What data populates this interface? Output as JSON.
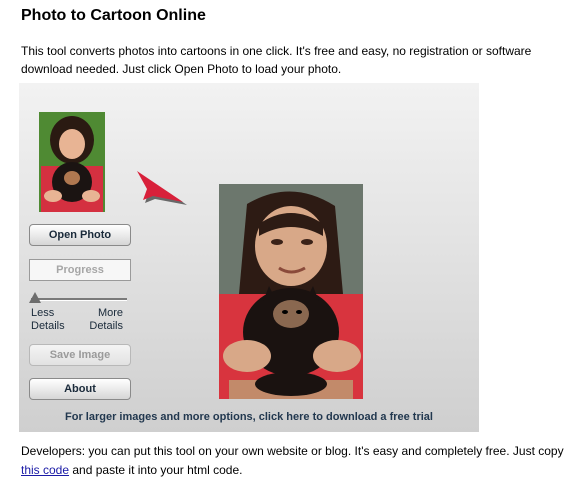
{
  "page": {
    "title": "Photo to Cartoon Online",
    "intro": "This tool converts photos into cartoons in one click. It's free and easy, no registration or software download needed. Just click Open Photo to load your photo."
  },
  "tool": {
    "open_photo": "Open Photo",
    "progress": "Progress",
    "slider_left_line1": "Less",
    "slider_left_line2": "Details",
    "slider_right_line1": "More",
    "slider_right_line2": "Details",
    "detail_level": 0,
    "save_image": "Save Image",
    "about": "About",
    "download_link": "For larger images and more options, click here to download a free trial"
  },
  "developers": {
    "text_before": "Developers: you can put this tool on your own website or blog. It's easy and completely free. Just copy ",
    "link": "this code",
    "text_after": " and paste it into your html code."
  },
  "colors": {
    "arrow_red": "#d8203a",
    "link_blue": "#1a1aa6",
    "panel_gray": "#dcdcdc"
  }
}
